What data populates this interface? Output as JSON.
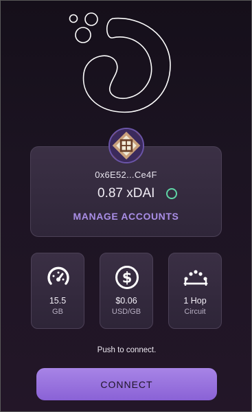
{
  "wallet": {
    "address": "0x6E52...Ce4F",
    "balance": "0.87 xDAI",
    "manage_label": "MANAGE ACCOUNTS"
  },
  "stats": [
    {
      "value": "15.5",
      "unit": "GB",
      "icon": "speedometer-icon"
    },
    {
      "value": "$0.06",
      "unit": "USD/GB",
      "icon": "dollar-icon"
    },
    {
      "value": "1 Hop",
      "unit": "Circuit",
      "icon": "circuit-icon"
    }
  ],
  "hint": "Push to connect.",
  "connect_label": "CONNECT",
  "colors": {
    "accent": "#9a74de",
    "status": "#5fd6a6",
    "link": "#a98ee6"
  }
}
